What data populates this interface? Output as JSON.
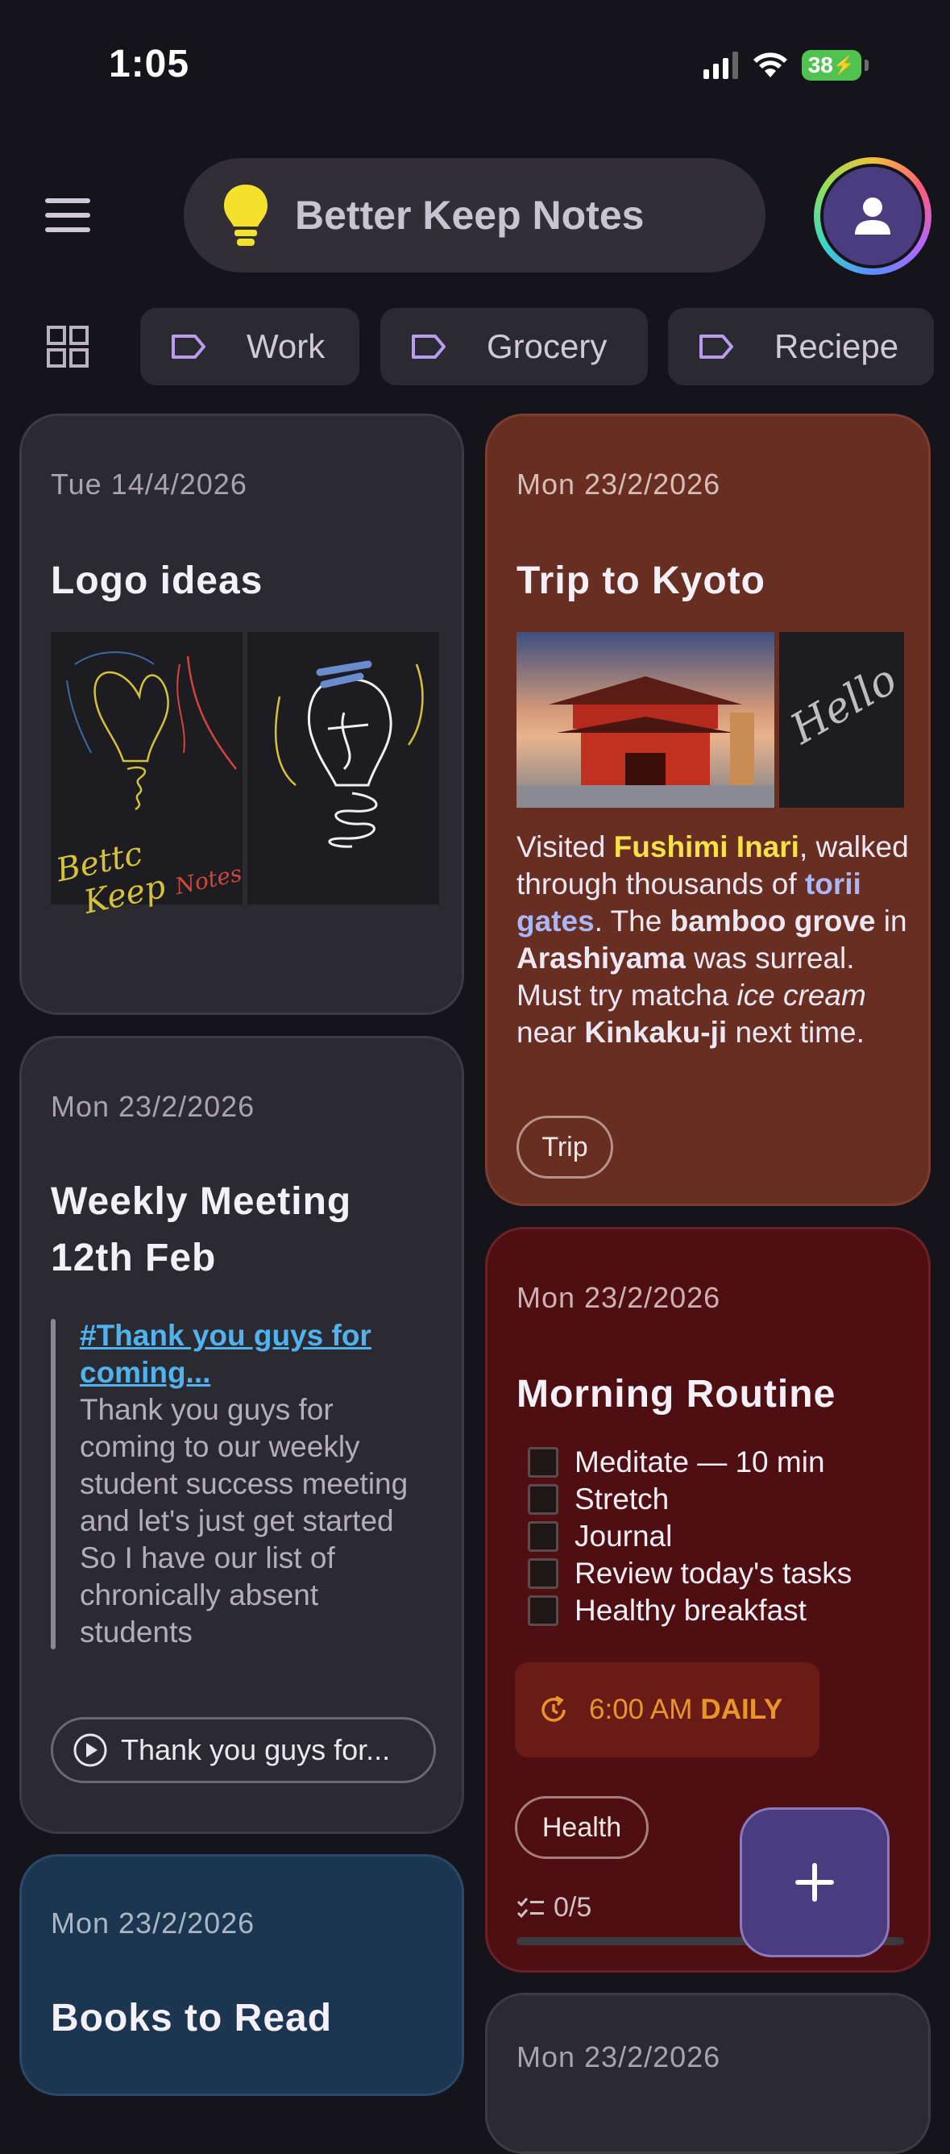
{
  "status": {
    "time": "1:05",
    "battery": "38"
  },
  "header": {
    "search_label": "Better Keep Notes"
  },
  "labels": [
    {
      "name": "Work"
    },
    {
      "name": "Grocery"
    },
    {
      "name": "Reciepe"
    }
  ],
  "notes": {
    "logo": {
      "date": "Tue 14/4/2026",
      "title": "Logo ideas",
      "sketch_text": "Better Keep Notes"
    },
    "kyoto": {
      "date": "Mon 23/2/2026",
      "title": "Trip to Kyoto",
      "image_text": "Hello",
      "body": {
        "p1": "Visited ",
        "h1": "Fushimi Inari",
        "p2": ", walked through thousands of ",
        "h2": "torii gates",
        "p3": ". The ",
        "b1": "bamboo grove",
        "p4": " in ",
        "b2": "Arashiyama",
        "p5": " was surreal. Must try matcha ",
        "i1": "ice cream",
        "p6": " near ",
        "b3": "Kinkaku-ji",
        "p7": " next time."
      },
      "tag": "Trip"
    },
    "meeting": {
      "date": "Mon 23/2/2026",
      "title_line1": "Weekly Meeting",
      "title_line2": "12th Feb",
      "quote_link": "#Thank you guys for coming...",
      "quote_text": "Thank you guys for coming to our weekly student success meeting and let's just get started So I have our list of chronically absent students",
      "audio_label": "Thank you guys for..."
    },
    "routine": {
      "date": "Mon 23/2/2026",
      "title": "Morning Routine",
      "items": [
        "Meditate — 10 min",
        "Stretch",
        "Journal",
        "Review today's tasks",
        "Healthy breakfast"
      ],
      "reminder_time": "6:00 AM",
      "reminder_repeat": "DAILY",
      "tag": "Health",
      "progress": "0/5",
      "progress_fraction": 0
    },
    "books": {
      "date": "Mon 23/2/2026",
      "title": "Books to Read"
    },
    "partial": {
      "date": "Mon 23/2/2026"
    }
  },
  "colors": {
    "background": "#16141b",
    "accent": "#4b3b7f",
    "highlight_yellow": "#f5e24a",
    "highlight_blue": "#a9b6f7",
    "reminder": "#e8962a",
    "link": "#4fb3f0"
  }
}
